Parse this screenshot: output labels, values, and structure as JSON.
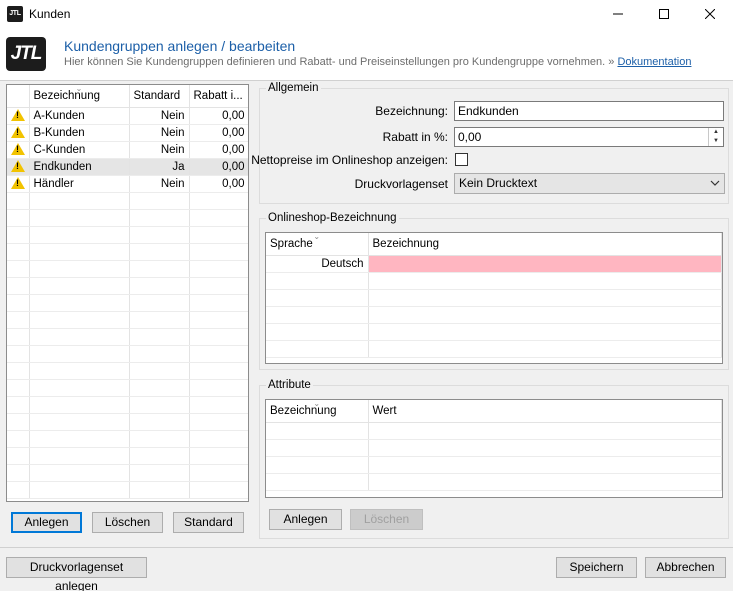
{
  "window": {
    "app_icon_label": "JTL",
    "title": "Kunden"
  },
  "header": {
    "logo_text": "JTL",
    "title": "Kundengruppen anlegen / bearbeiten",
    "subtitle": "Hier können Sie Kundengruppen definieren und Rabatt- und Preiseinstellungen pro Kundengruppe vornehmen.",
    "doc_prefix": "»",
    "doc_link": "Dokumentation"
  },
  "group_list": {
    "columns": [
      "Bezeichnung",
      "Standard",
      "Rabatt i..."
    ],
    "rows": [
      {
        "name": "A-Kunden",
        "standard": "Nein",
        "rabatt": "0,00"
      },
      {
        "name": "B-Kunden",
        "standard": "Nein",
        "rabatt": "0,00"
      },
      {
        "name": "C-Kunden",
        "standard": "Nein",
        "rabatt": "0,00"
      },
      {
        "name": "Endkunden",
        "standard": "Ja",
        "rabatt": "0,00"
      },
      {
        "name": "Händler",
        "standard": "Nein",
        "rabatt": "0,00"
      }
    ],
    "selected_index": 3,
    "buttons": {
      "add": "Anlegen",
      "delete": "Löschen",
      "standard": "Standard"
    }
  },
  "allgemein": {
    "label": "Allgemein",
    "bezeichnung_label": "Bezeichnung:",
    "bezeichnung_value": "Endkunden",
    "rabatt_label": "Rabatt in %:",
    "rabatt_value": "0,00",
    "netto_label": "Nettopreise im Onlineshop anzeigen:",
    "netto_checked": false,
    "druck_label": "Druckvorlagenset",
    "druck_value": "Kein Drucktext"
  },
  "onlineshop": {
    "label": "Onlineshop-Bezeichnung",
    "columns": [
      "Sprache",
      "Bezeichnung"
    ],
    "rows": [
      {
        "sprache": "Deutsch",
        "bezeichnung": ""
      }
    ],
    "highlight_color": "#ffb6c1"
  },
  "attribute": {
    "label": "Attribute",
    "columns": [
      "Bezeichnung",
      "Wert"
    ],
    "buttons": {
      "add": "Anlegen",
      "delete": "Löschen"
    }
  },
  "footer": {
    "druck_button": "Druckvorlagenset anlegen",
    "save": "Speichern",
    "cancel": "Abbrechen"
  },
  "colors": {
    "accent": "#1c5fa8",
    "warning": "#f2c300"
  },
  "icons": [
    "jtl-app-icon",
    "minimize-icon",
    "maximize-icon",
    "close-icon",
    "warning-icon",
    "sort-indicator-icon",
    "spin-up-icon",
    "spin-down-icon",
    "chevron-down-icon"
  ]
}
